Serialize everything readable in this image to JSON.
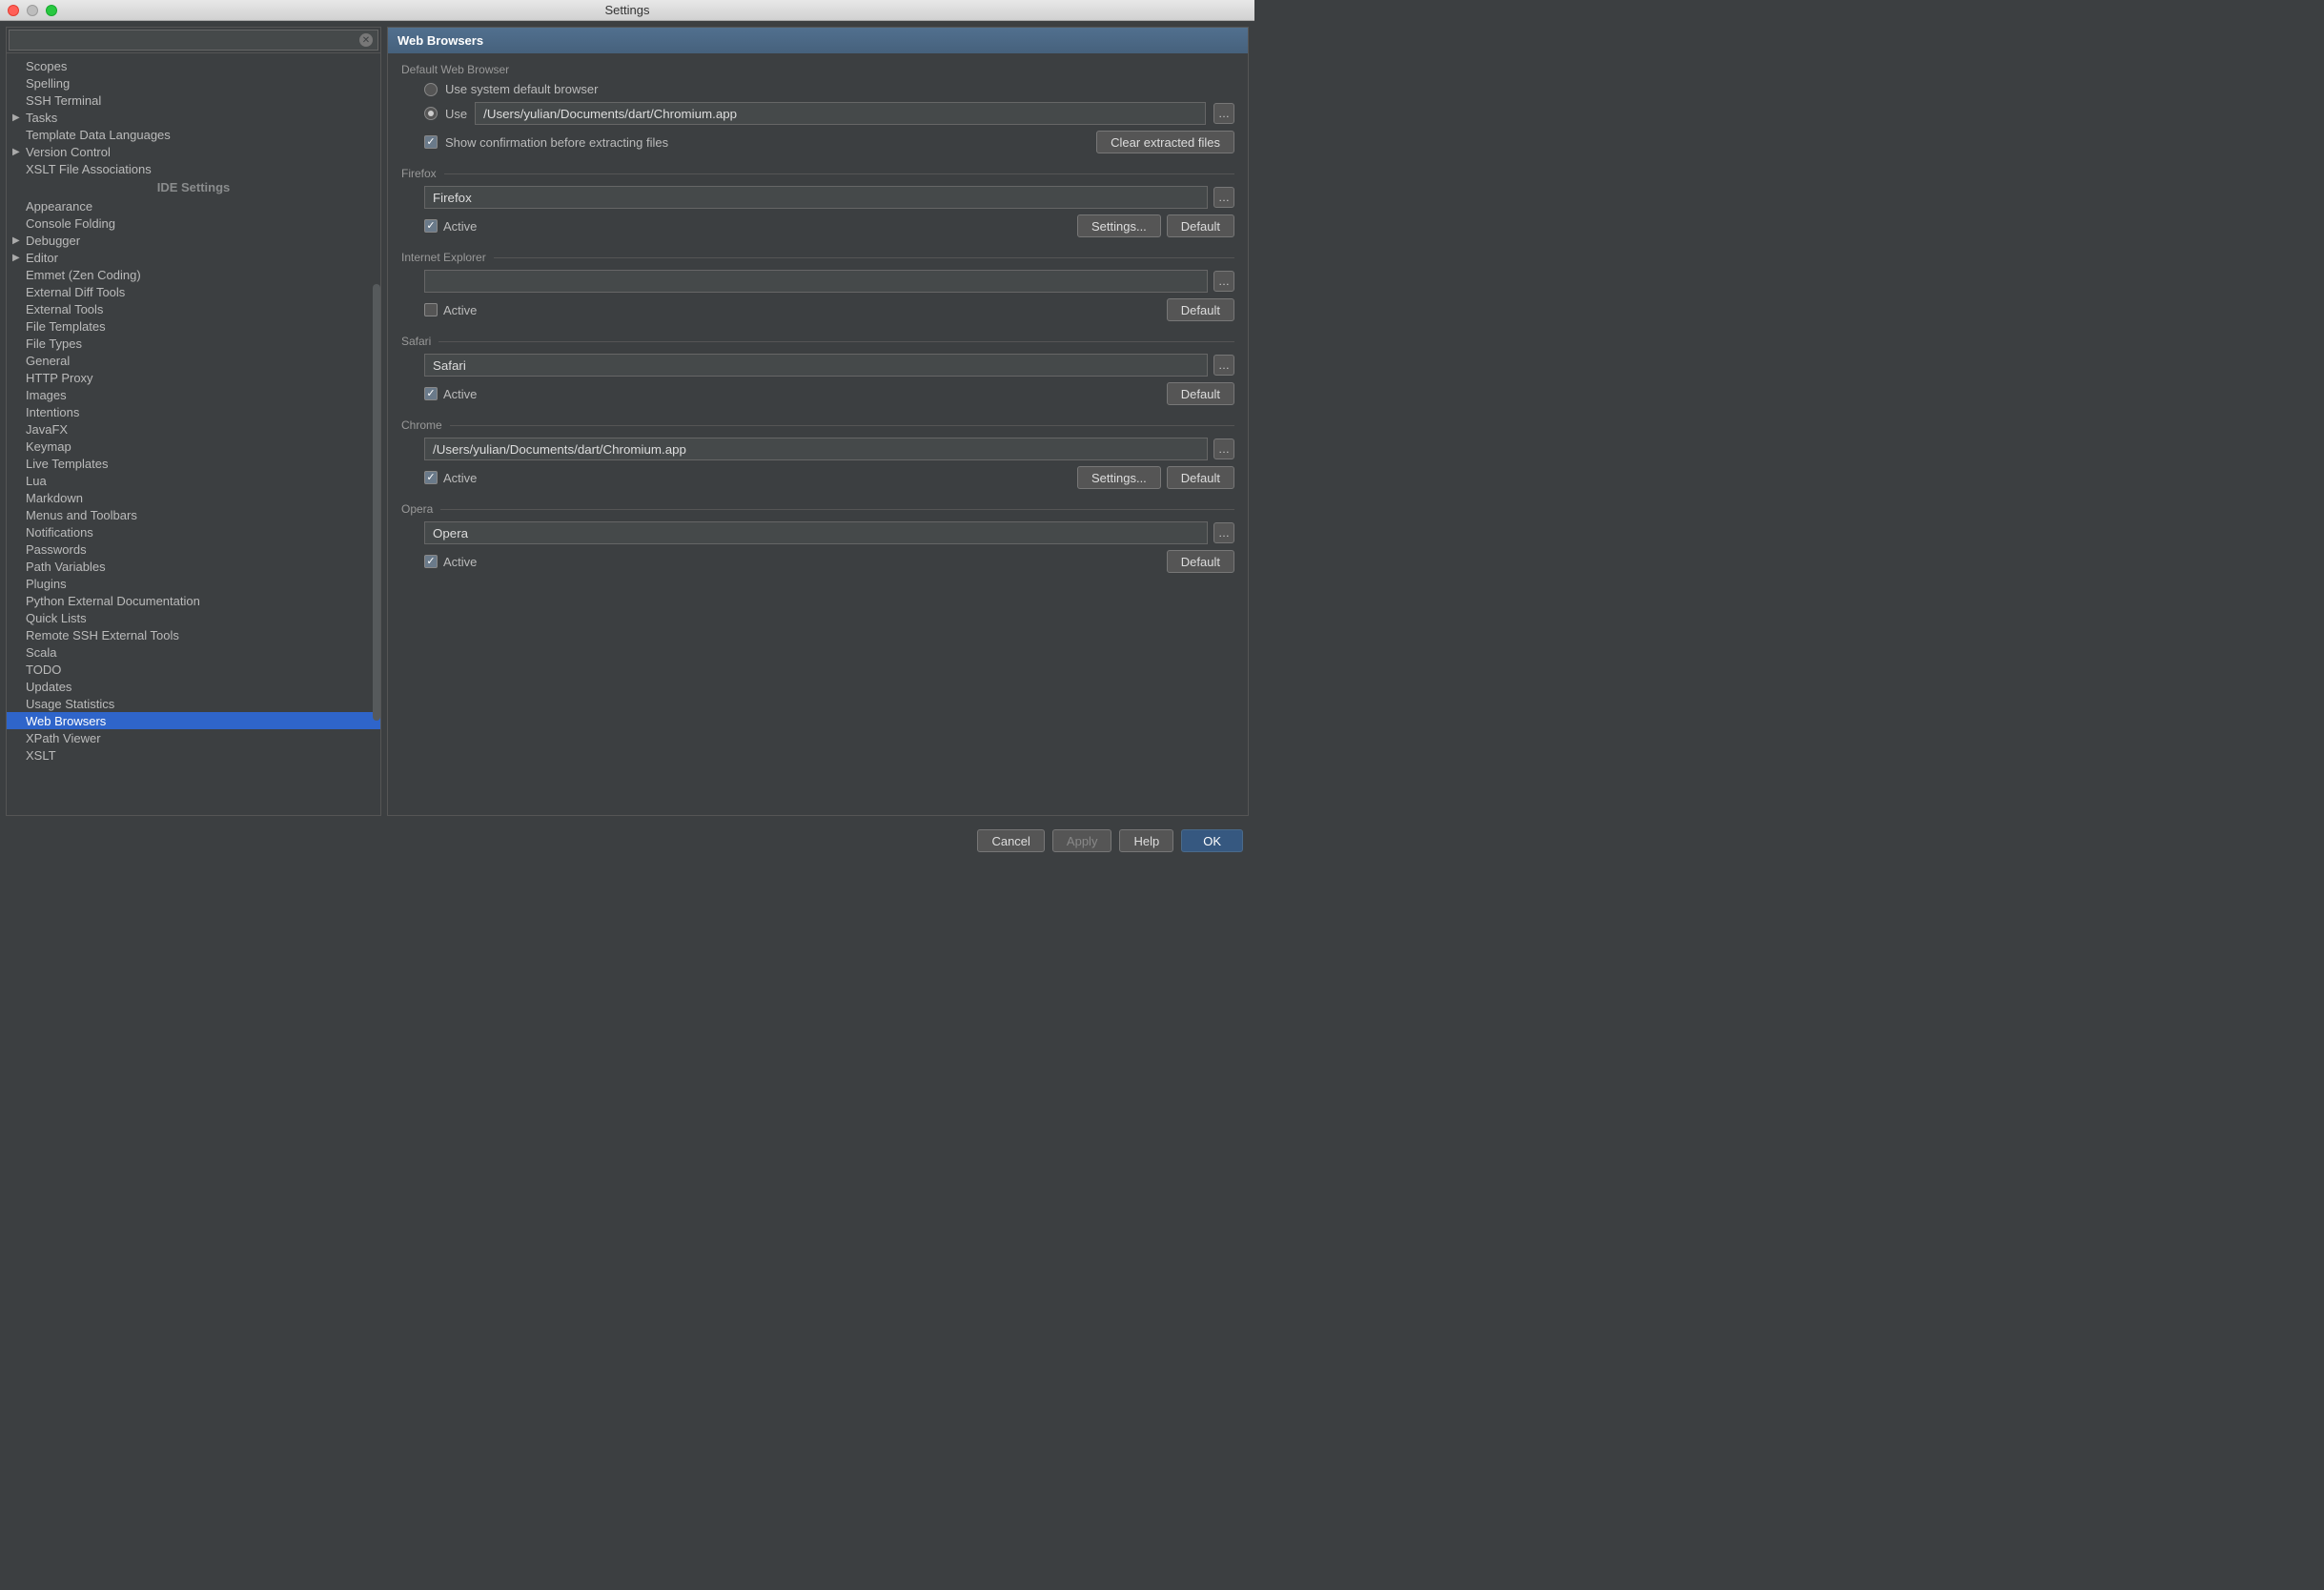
{
  "window": {
    "title": "Settings"
  },
  "sidebar": {
    "search_placeholder": "",
    "items_top": [
      {
        "label": "Scopes",
        "expandable": false
      },
      {
        "label": "Spelling",
        "expandable": false
      },
      {
        "label": "SSH Terminal",
        "expandable": false
      },
      {
        "label": "Tasks",
        "expandable": true
      },
      {
        "label": "Template Data Languages",
        "expandable": false
      },
      {
        "label": "Version Control",
        "expandable": true
      },
      {
        "label": "XSLT File Associations",
        "expandable": false
      }
    ],
    "ide_header": "IDE Settings",
    "items_ide": [
      {
        "label": "Appearance",
        "expandable": false
      },
      {
        "label": "Console Folding",
        "expandable": false
      },
      {
        "label": "Debugger",
        "expandable": true
      },
      {
        "label": "Editor",
        "expandable": true
      },
      {
        "label": "Emmet (Zen Coding)",
        "expandable": false
      },
      {
        "label": "External Diff Tools",
        "expandable": false
      },
      {
        "label": "External Tools",
        "expandable": false
      },
      {
        "label": "File Templates",
        "expandable": false
      },
      {
        "label": "File Types",
        "expandable": false
      },
      {
        "label": "General",
        "expandable": false
      },
      {
        "label": "HTTP Proxy",
        "expandable": false
      },
      {
        "label": "Images",
        "expandable": false
      },
      {
        "label": "Intentions",
        "expandable": false
      },
      {
        "label": "JavaFX",
        "expandable": false
      },
      {
        "label": "Keymap",
        "expandable": false
      },
      {
        "label": "Live Templates",
        "expandable": false
      },
      {
        "label": "Lua",
        "expandable": false
      },
      {
        "label": "Markdown",
        "expandable": false
      },
      {
        "label": "Menus and Toolbars",
        "expandable": false
      },
      {
        "label": "Notifications",
        "expandable": false
      },
      {
        "label": "Passwords",
        "expandable": false
      },
      {
        "label": "Path Variables",
        "expandable": false
      },
      {
        "label": "Plugins",
        "expandable": false
      },
      {
        "label": "Python External Documentation",
        "expandable": false
      },
      {
        "label": "Quick Lists",
        "expandable": false
      },
      {
        "label": "Remote SSH External Tools",
        "expandable": false
      },
      {
        "label": "Scala",
        "expandable": false
      },
      {
        "label": "TODO",
        "expandable": false
      },
      {
        "label": "Updates",
        "expandable": false
      },
      {
        "label": "Usage Statistics",
        "expandable": false
      },
      {
        "label": "Web Browsers",
        "expandable": false,
        "selected": true
      },
      {
        "label": "XPath Viewer",
        "expandable": false
      },
      {
        "label": "XSLT",
        "expandable": false
      }
    ]
  },
  "main": {
    "title": "Web Browsers",
    "default_section": {
      "title": "Default Web Browser",
      "option_system": "Use system default browser",
      "option_use": "Use",
      "use_path": "/Users/yulian/Documents/dart/Chromium.app",
      "show_confirm": "Show confirmation before extracting files",
      "clear_btn": "Clear extracted files"
    },
    "browsers": [
      {
        "title": "Firefox",
        "path": "Firefox",
        "active": true,
        "has_settings": true
      },
      {
        "title": "Internet Explorer",
        "path": "",
        "active": false,
        "has_settings": false
      },
      {
        "title": "Safari",
        "path": "Safari",
        "active": true,
        "has_settings": false
      },
      {
        "title": "Chrome",
        "path": "/Users/yulian/Documents/dart/Chromium.app",
        "active": true,
        "has_settings": true
      },
      {
        "title": "Opera",
        "path": "Opera",
        "active": true,
        "has_settings": false
      }
    ],
    "labels": {
      "active": "Active",
      "settings": "Settings...",
      "default": "Default"
    }
  },
  "buttons": {
    "cancel": "Cancel",
    "apply": "Apply",
    "help": "Help",
    "ok": "OK"
  }
}
